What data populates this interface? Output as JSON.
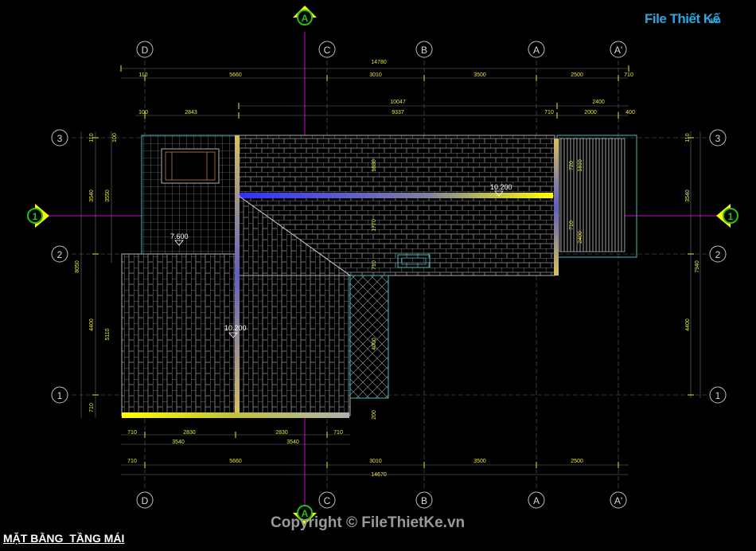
{
  "title": "MẶT BẰNG  TẦNG MÁI",
  "copyright": "Copyright © FileThietKe.vn",
  "logo": {
    "brand": "File Thiết Kế",
    "suffix": ".vn"
  },
  "grid_top": {
    "D": "D",
    "C": "C",
    "B": "B",
    "A": "A",
    "A2": "A'"
  },
  "grid_side": {
    "r3": "3",
    "r2": "2",
    "r1": "1"
  },
  "section": {
    "cut_label": "A",
    "cut_label_side": "1"
  },
  "levels": {
    "top_ridge": "10.200",
    "left_ridge": "10.200",
    "low_roof": "7.600"
  },
  "dims_top": {
    "overall": "14780",
    "d110": "110",
    "d5660": "5660",
    "d3010": "3010",
    "d3500": "3500",
    "d2500": "2500",
    "d710": "710",
    "span10047": "10047",
    "span9337": "9337",
    "span2400": "2400",
    "d100": "100",
    "d2843": "2843",
    "d710b": "710",
    "d2000": "2000",
    "d400": "400"
  },
  "dims_bottom": {
    "a710": "710",
    "a2830": "2830",
    "a2830b": "2830",
    "a710b": "710",
    "b3540": "3540",
    "b3540b": "3540",
    "c710": "710",
    "c5660": "5660",
    "c3010": "3010",
    "c3500": "3500",
    "c2500": "2500",
    "overall": "14670"
  },
  "dims_left": {
    "l110": "110",
    "l100": "100",
    "l3540": "3540",
    "l3550": "3550",
    "l8050": "8050",
    "l4400": "4400",
    "l5110": "5110",
    "l710": "710"
  },
  "dims_right": {
    "r110": "110",
    "r3540": "3540",
    "r7940": "7940",
    "r4400": "4400"
  },
  "dims_inner": {
    "i1880": "1880",
    "i1770": "1770",
    "i710": "710",
    "i4000": "4000",
    "i200": "200",
    "i720": "720",
    "i1810": "1810",
    "i710b": "710",
    "i2400": "2400"
  },
  "colors": {
    "background": "#000000",
    "grid_line": "#d000d0",
    "dim": "#e6e640",
    "roof_line": "#b8b8b8",
    "ridge_yellow": "#ffff00",
    "ridge_blue": "#3030ff",
    "cyan": "#40c0c0",
    "marker_green": "#20c020"
  }
}
